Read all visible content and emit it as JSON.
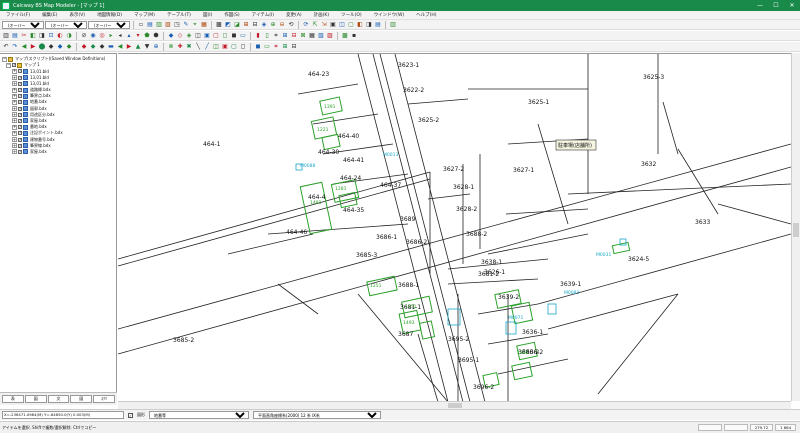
{
  "app": {
    "title": "Calcway BS Map Modeler - [マップ 1]"
  },
  "window_buttons": [
    "—",
    "☐",
    "✕"
  ],
  "menu": [
    "ファイル(F)",
    "編集(E)",
    "表示(V)",
    "地図情報(D)",
    "マップ(M)",
    "テーブル(T)",
    "図(I)",
    "作図(S)",
    "アイテム(I)",
    "変更(A)",
    "計画(K)",
    "ツール(O)",
    "ウインドウ(W)",
    "ヘルプ(H)"
  ],
  "toolbar": {
    "combo1": "(オーバーレイ)",
    "combo2": "(オーバーレイ)",
    "combo3": "(オーバーレイ)"
  },
  "tree": {
    "root": "マップ(スクリプト)(Saved Window Definitions)",
    "map": "マップ 1",
    "layers": [
      "13,01.bld",
      "13,01.bld",
      "13,01.bld",
      "道路縁.bdx",
      "筆界点.bdx",
      "地番.bdx",
      "図郭.bdx",
      "用途区分.bdx",
      "家屋.bdx",
      "番地.bdx",
      "注記ポイント.bdx",
      "建物番号.bdx",
      "筆界線.bdx",
      "家屋.bdx"
    ]
  },
  "side_tabs": [
    "表",
    "図",
    "文",
    "図",
    "ｽｸﾘ"
  ],
  "map_labels": {
    "parcels": [
      "464-23",
      "464-1",
      "464-30",
      "464-40",
      "464-41",
      "464-24",
      "464-37",
      "464-35",
      "464-46",
      "464-4",
      "3623-1",
      "3622-2",
      "3625-2",
      "3625-3",
      "3625-1",
      "3627-2",
      "3628-1",
      "3627-1",
      "3632",
      "3633",
      "3628-2",
      "3688-2",
      "3689",
      "3686-1",
      "3686-2",
      "3685-3",
      "3688-1",
      "3685-2",
      "3681-2",
      "3624-5",
      "3639-1",
      "3639-2",
      "3636-1",
      "3636-2",
      "3686-2",
      "3681-1",
      "3687",
      "3695-2",
      "3695-1",
      "3696-2",
      "3638-1",
      "3626-1"
    ],
    "houses": [
      "1391",
      "1221",
      "1481",
      "1281",
      "1251",
      "1251",
      "1493",
      "1384"
    ],
    "cyan": [
      "M0088",
      "M0013",
      "M0031",
      "M0071",
      "M0083"
    ],
    "boxed": "駐車場(店舗所)"
  },
  "status": {
    "coords": "X=-236471.0984(M)  Y=-64650.0(Y) 0.003(M)",
    "snap_label": "図形",
    "combo_a": "地番等",
    "combo_b": "平面直角座標系(2000) 12 系 Ⅸ系"
  },
  "bottom": {
    "hint": "アイテムを選択. Shiftで複数/選択解除. Ctrlでコピー",
    "cells": [
      "",
      "",
      "279.72",
      "1 664"
    ]
  },
  "colors": {
    "titlebar": "#1a8a4a",
    "house": "#2aa12a",
    "cyan": "#1aa6c7",
    "lines": "#222222"
  }
}
